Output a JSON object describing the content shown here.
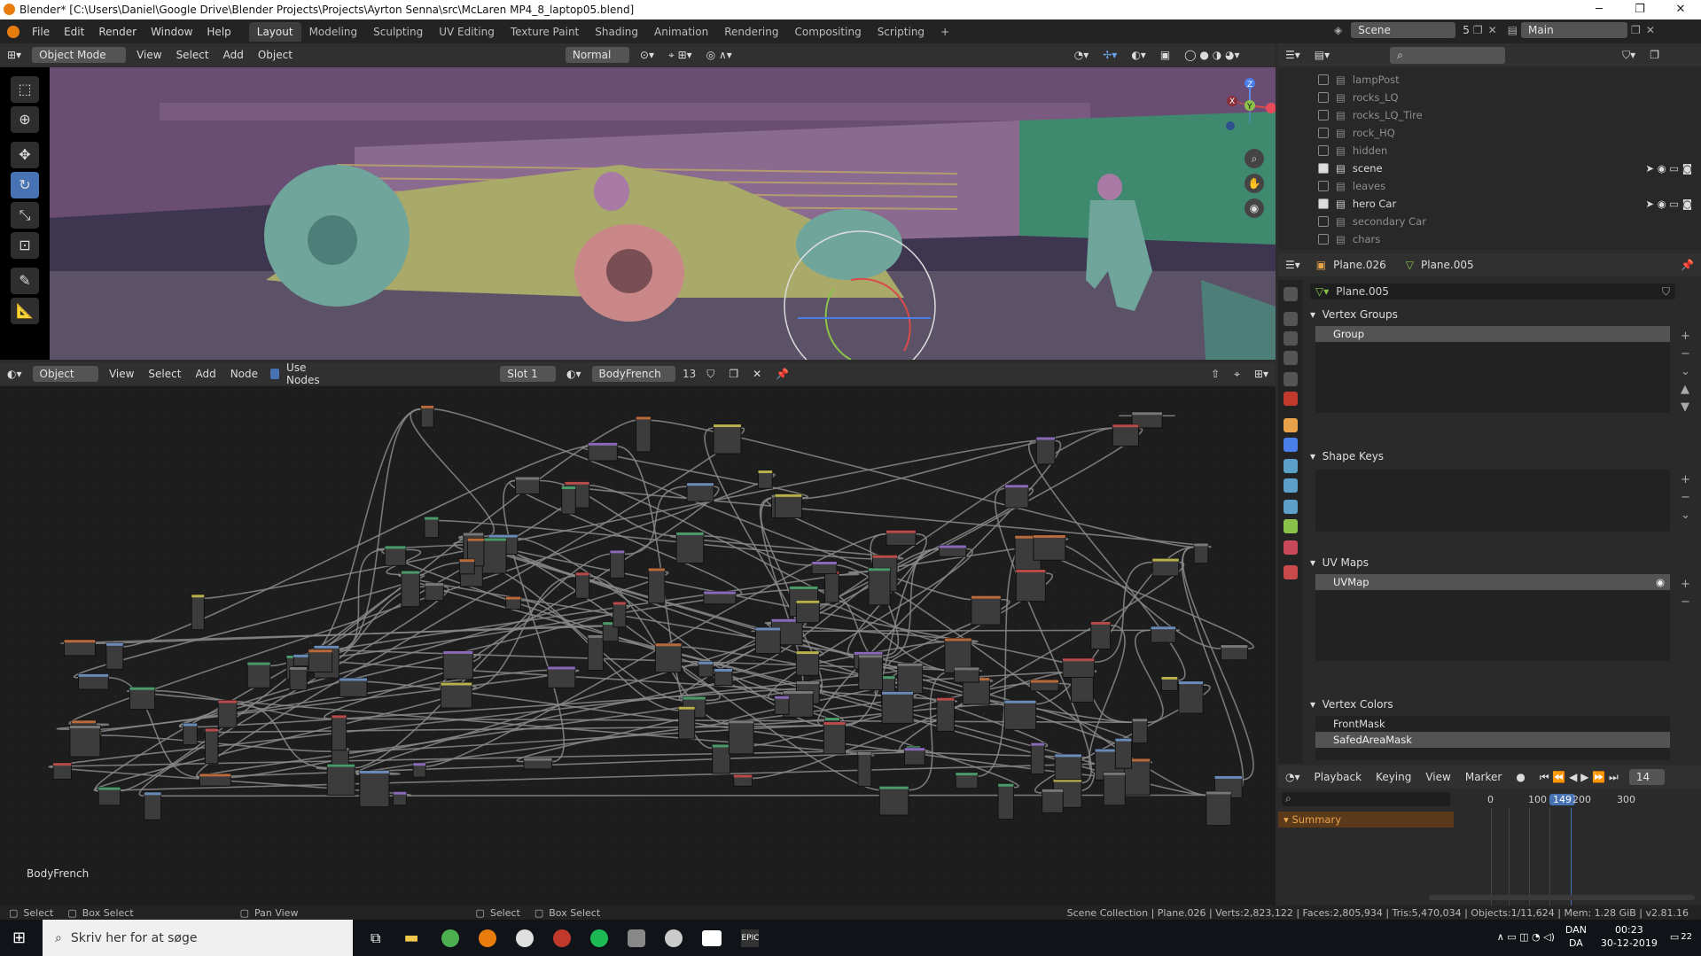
{
  "window": {
    "title": "Blender* [C:\\Users\\Daniel\\Google Drive\\Blender Projects\\Projects\\Ayrton Senna\\src\\McLaren MP4_8_laptop05.blend]"
  },
  "menu": [
    "File",
    "Edit",
    "Render",
    "Window",
    "Help"
  ],
  "workspaces": [
    "Layout",
    "Modeling",
    "Sculpting",
    "UV Editing",
    "Texture Paint",
    "Shading",
    "Animation",
    "Rendering",
    "Compositing",
    "Scripting"
  ],
  "active_workspace": "Layout",
  "scene": {
    "name": "Scene",
    "count": "5",
    "view_layer": "Main"
  },
  "viewport_header": {
    "mode": "Object Mode",
    "items": [
      "View",
      "Select",
      "Add",
      "Object"
    ],
    "orientation": "Normal"
  },
  "node_header": {
    "type": "Object",
    "items": [
      "View",
      "Select",
      "Add",
      "Node"
    ],
    "use_nodes": "Use Nodes",
    "slot": "Slot 1",
    "material": "BodyFrench",
    "users": "13"
  },
  "node_editor": {
    "material_label": "BodyFrench"
  },
  "outliner": {
    "rows": [
      {
        "name": "lampPost",
        "checked": false
      },
      {
        "name": "rocks_LQ",
        "checked": false
      },
      {
        "name": "rocks_LQ_Tire",
        "checked": false
      },
      {
        "name": "rock_HQ",
        "checked": false
      },
      {
        "name": "hidden",
        "checked": false
      },
      {
        "name": "scene",
        "checked": true
      },
      {
        "name": "leaves",
        "checked": false
      },
      {
        "name": "hero Car",
        "checked": true
      },
      {
        "name": "secondary Car",
        "checked": false
      },
      {
        "name": "chars",
        "checked": false
      }
    ]
  },
  "properties": {
    "object": "Plane.026",
    "data": "Plane.005",
    "mesh_name": "Plane.005",
    "panels": {
      "vertex_groups": "Vertex Groups",
      "vertex_group_item": "Group",
      "shape_keys": "Shape Keys",
      "uv_maps": "UV Maps",
      "uv_map_item": "UVMap",
      "vertex_colors": "Vertex Colors",
      "vc_item1": "FrontMask",
      "vc_item2": "SafedAreaMask"
    }
  },
  "timeline": {
    "items": [
      "Playback",
      "Keying",
      "View",
      "Marker"
    ],
    "frame_labels": [
      "0",
      "100",
      "149",
      "200",
      "300"
    ],
    "current_frame": "149",
    "summary": "Summary",
    "frame_field": "14"
  },
  "statusbar": {
    "left": [
      "Select",
      "Box Select",
      "Pan View",
      "Select",
      "Box Select"
    ],
    "stats": "Scene Collection | Plane.026 | Verts:2,823,122 | Faces:2,805,934 | Tris:5,470,034 | Objects:1/11,624 | Mem: 1.28 GiB | v2.81.16"
  },
  "taskbar": {
    "search": "Skriv her for at søge",
    "lang1": "DAN",
    "lang2": "DA",
    "time": "00:23",
    "date": "30-12-2019",
    "notif": "22"
  }
}
